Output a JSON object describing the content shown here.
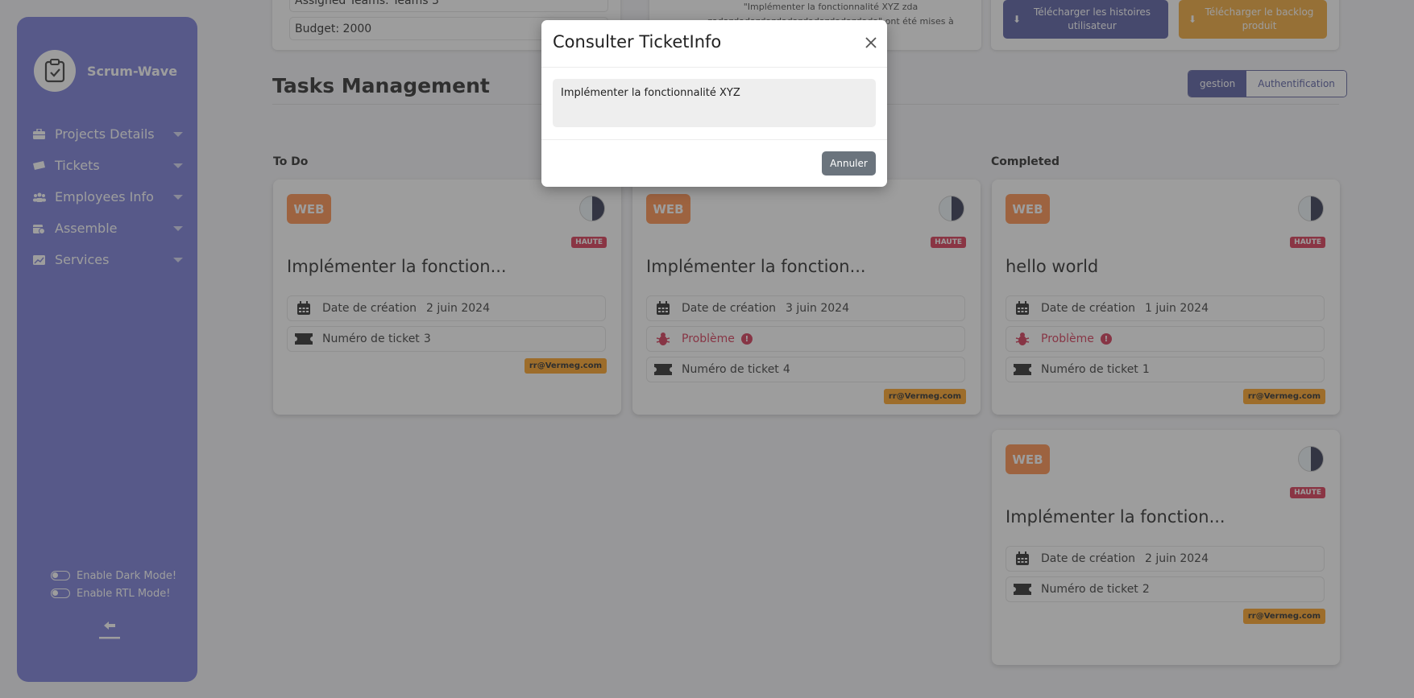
{
  "sidebar": {
    "brand": "Scrum-Wave",
    "items": [
      {
        "label": "Projects Details",
        "icon": "briefcase-icon"
      },
      {
        "label": "Tickets",
        "icon": "ticket-icon"
      },
      {
        "label": "Employees Info",
        "icon": "users-icon"
      },
      {
        "label": "Assemble",
        "icon": "calendar-gear-icon"
      },
      {
        "label": "Services",
        "icon": "chart-window-icon"
      }
    ],
    "dark_mode_label": "Enable Dark Mode!",
    "rtl_mode_label": "Enable RTL Mode!"
  },
  "top": {
    "assigned_teams_label": "Assigned Teams:",
    "assigned_teams_value": "Teams 3",
    "budget_label": "Budget:",
    "budget_value": "2000",
    "notice": "\"Implémenter la fonctionnalité XYZ zda zadazdadazdazdadazdadazdadazdada\" ont été mises à jour.",
    "download_stories": "Télécharger les histoires utilisateur",
    "download_backlog": "Télécharger le backlog produit"
  },
  "main": {
    "title": "Tasks Management",
    "tabs": [
      "gestion",
      "Authentification"
    ],
    "columns": [
      {
        "title": "To Do"
      },
      {
        "title": ""
      },
      {
        "title": "Completed"
      }
    ]
  },
  "tasks": [
    {
      "badge": "WEB",
      "priority": "HAUTE",
      "title": "Implémenter la fonction...",
      "date_label": "Date de création",
      "date": "2 juin 2024",
      "ticket_label": "Numéro de ticket",
      "ticket": "3",
      "email": "rr@Vermeg.com"
    },
    {
      "badge": "WEB",
      "priority": "HAUTE",
      "title": "Implémenter la fonction...",
      "date_label": "Date de création",
      "date": "3 juin 2024",
      "problem": "Problème",
      "ticket_label": "Numéro de ticket",
      "ticket": "4",
      "email": "rr@Vermeg.com"
    },
    {
      "badge": "WEB",
      "priority": "HAUTE",
      "title": "hello world",
      "date_label": "Date de création",
      "date": "1 juin 2024",
      "problem": "Problème",
      "ticket_label": "Numéro de ticket",
      "ticket": "1",
      "email": "rr@Vermeg.com"
    },
    {
      "badge": "WEB",
      "priority": "HAUTE",
      "title": "Implémenter la fonction...",
      "date_label": "Date de création",
      "date": "2 juin 2024",
      "ticket_label": "Numéro de ticket",
      "ticket": "2",
      "email": "rr@Vermeg.com"
    }
  ],
  "modal": {
    "title": "Consulter TicketInfo",
    "content": "Implémenter la fonctionnalité XYZ",
    "cancel": "Annuler"
  },
  "colors": {
    "sidebar": "#7277d6",
    "web_badge": "#ff8a45",
    "priority": "#d92f4d",
    "email_badge": "#ff9f1a",
    "download_stories_btn": "#51569e",
    "download_backlog_btn": "#f0a430"
  }
}
